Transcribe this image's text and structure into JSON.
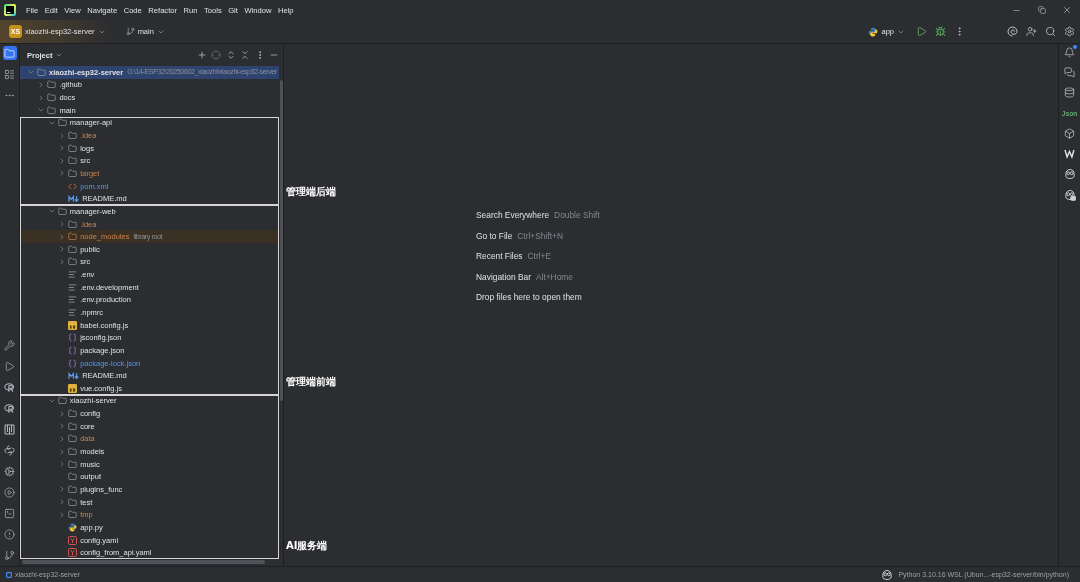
{
  "menu": [
    "File",
    "Edit",
    "View",
    "Navigate",
    "Code",
    "Refactor",
    "Run",
    "Tools",
    "Git",
    "Window",
    "Help"
  ],
  "toolbar": {
    "project_badge": "XS",
    "project": "xiaozhi-esp32-server",
    "branch": "main",
    "run_configuration": "app"
  },
  "left_toolbar": {
    "top": [
      {
        "kind": "project",
        "selected": true
      },
      {
        "kind": "structure",
        "selected": false
      },
      {
        "kind": "more",
        "selected": false
      }
    ],
    "bottom": [
      {
        "kind": "build",
        "selected": false
      },
      {
        "kind": "run",
        "selected": false
      },
      {
        "kind": "r-console",
        "selected": false
      },
      {
        "kind": "r-packages",
        "selected": false
      },
      {
        "kind": "columns",
        "selected": false
      },
      {
        "kind": "python-console",
        "selected": false
      },
      {
        "kind": "services",
        "selected": false
      },
      {
        "kind": "play-circle",
        "selected": false
      },
      {
        "kind": "terminal",
        "selected": false
      },
      {
        "kind": "problems",
        "selected": false
      },
      {
        "kind": "vcs",
        "selected": false
      }
    ]
  },
  "project_panel": {
    "title": "Project",
    "tree": [
      {
        "name": "xiaozhi-esp32-server",
        "hint": "G:\\14-ESP32\\20250602_xiaozhi\\xiaozhi-esp32-server",
        "kind": "folder",
        "ignored": false,
        "modified": false,
        "expanded": true,
        "selected": true,
        "highlighted": false,
        "children": [
          {
            "name": ".github",
            "kind": "folder",
            "ignored": false,
            "modified": false,
            "expanded": false,
            "selected": false,
            "highlighted": false
          },
          {
            "name": "docs",
            "kind": "folder",
            "ignored": false,
            "modified": false,
            "expanded": false,
            "selected": false,
            "highlighted": false
          },
          {
            "name": "main",
            "kind": "folder",
            "ignored": false,
            "modified": false,
            "expanded": true,
            "selected": false,
            "highlighted": false,
            "children": [
              {
                "name": "manager-api",
                "kind": "folder",
                "ignored": false,
                "modified": false,
                "expanded": true,
                "selected": false,
                "highlighted": false,
                "annotation": "管理端后端",
                "children": [
                  {
                    "name": ".idea",
                    "kind": "folder",
                    "ignored": true,
                    "modified": false,
                    "expanded": false,
                    "selected": false,
                    "highlighted": false
                  },
                  {
                    "name": "logs",
                    "kind": "folder",
                    "ignored": false,
                    "modified": false,
                    "expanded": false,
                    "selected": false,
                    "highlighted": false
                  },
                  {
                    "name": "src",
                    "kind": "folder",
                    "ignored": false,
                    "modified": false,
                    "expanded": false,
                    "selected": false,
                    "highlighted": false
                  },
                  {
                    "name": "target",
                    "kind": "folder",
                    "ignored": true,
                    "modified": false,
                    "expanded": false,
                    "selected": false,
                    "highlighted": false
                  },
                  {
                    "name": "pom.xml",
                    "kind": "xml",
                    "ignored": false,
                    "modified": true,
                    "selected": false,
                    "highlighted": false
                  },
                  {
                    "name": "README.md",
                    "kind": "markdown",
                    "ignored": false,
                    "modified": false,
                    "selected": false,
                    "highlighted": false
                  }
                ]
              },
              {
                "name": "manager-web",
                "kind": "folder",
                "ignored": false,
                "modified": false,
                "expanded": true,
                "selected": false,
                "highlighted": false,
                "annotation": "管理端前端",
                "children": [
                  {
                    "name": ".idea",
                    "kind": "folder",
                    "ignored": true,
                    "modified": false,
                    "expanded": false,
                    "selected": false,
                    "highlighted": false
                  },
                  {
                    "name": "node_modules",
                    "hint": "library root",
                    "kind": "folder",
                    "ignored": true,
                    "modified": false,
                    "expanded": false,
                    "selected": false,
                    "highlighted": true
                  },
                  {
                    "name": "public",
                    "kind": "folder",
                    "ignored": false,
                    "modified": false,
                    "expanded": false,
                    "selected": false,
                    "highlighted": false
                  },
                  {
                    "name": "src",
                    "kind": "folder",
                    "ignored": false,
                    "modified": false,
                    "expanded": false,
                    "selected": false,
                    "highlighted": false
                  },
                  {
                    "name": ".env",
                    "kind": "text",
                    "ignored": false,
                    "modified": false,
                    "selected": false,
                    "highlighted": false
                  },
                  {
                    "name": ".env.development",
                    "kind": "text",
                    "ignored": false,
                    "modified": false,
                    "selected": false,
                    "highlighted": false
                  },
                  {
                    "name": ".env.production",
                    "kind": "text",
                    "ignored": false,
                    "modified": false,
                    "selected": false,
                    "highlighted": false
                  },
                  {
                    "name": ".npmrc",
                    "kind": "text",
                    "ignored": false,
                    "modified": false,
                    "selected": false,
                    "highlighted": false
                  },
                  {
                    "name": "babel.config.js",
                    "kind": "js",
                    "ignored": false,
                    "modified": false,
                    "selected": false,
                    "highlighted": false
                  },
                  {
                    "name": "jsconfig.json",
                    "kind": "json",
                    "ignored": false,
                    "modified": false,
                    "selected": false,
                    "highlighted": false
                  },
                  {
                    "name": "package.json",
                    "kind": "json",
                    "ignored": false,
                    "modified": false,
                    "selected": false,
                    "highlighted": false
                  },
                  {
                    "name": "package-lock.json",
                    "kind": "json",
                    "ignored": false,
                    "modified": true,
                    "selected": false,
                    "highlighted": false
                  },
                  {
                    "name": "README.md",
                    "kind": "markdown",
                    "ignored": false,
                    "modified": false,
                    "selected": false,
                    "highlighted": false
                  },
                  {
                    "name": "vue.config.js",
                    "kind": "js",
                    "ignored": false,
                    "modified": false,
                    "selected": false,
                    "highlighted": false
                  }
                ]
              },
              {
                "name": "xiaozhi-server",
                "kind": "folder",
                "ignored": false,
                "modified": false,
                "expanded": true,
                "selected": false,
                "highlighted": false,
                "annotation": "AI服务端",
                "children": [
                  {
                    "name": "config",
                    "kind": "folder",
                    "ignored": false,
                    "modified": false,
                    "expanded": false,
                    "selected": false,
                    "highlighted": false
                  },
                  {
                    "name": "core",
                    "kind": "folder",
                    "ignored": false,
                    "modified": false,
                    "expanded": false,
                    "selected": false,
                    "highlighted": false
                  },
                  {
                    "name": "data",
                    "kind": "folder",
                    "ignored": true,
                    "modified": false,
                    "expanded": false,
                    "selected": false,
                    "highlighted": false
                  },
                  {
                    "name": "models",
                    "kind": "folder",
                    "ignored": false,
                    "modified": false,
                    "expanded": false,
                    "selected": false,
                    "highlighted": false
                  },
                  {
                    "name": "music",
                    "kind": "folder",
                    "ignored": false,
                    "modified": false,
                    "expanded": false,
                    "selected": false,
                    "highlighted": false
                  },
                  {
                    "name": "output",
                    "kind": "empty-folder",
                    "ignored": false,
                    "modified": false,
                    "selected": false,
                    "highlighted": false
                  },
                  {
                    "name": "plugins_func",
                    "kind": "folder",
                    "ignored": false,
                    "modified": false,
                    "expanded": false,
                    "selected": false,
                    "highlighted": false
                  },
                  {
                    "name": "test",
                    "kind": "folder",
                    "ignored": false,
                    "modified": false,
                    "expanded": false,
                    "selected": false,
                    "highlighted": false
                  },
                  {
                    "name": "tmp",
                    "kind": "folder",
                    "ignored": true,
                    "modified": false,
                    "expanded": false,
                    "selected": false,
                    "highlighted": false
                  },
                  {
                    "name": "app.py",
                    "kind": "python",
                    "ignored": false,
                    "modified": false,
                    "selected": false,
                    "highlighted": false
                  },
                  {
                    "name": "config.yaml",
                    "kind": "yaml",
                    "ignored": false,
                    "modified": false,
                    "selected": false,
                    "highlighted": false
                  },
                  {
                    "name": "config_from_api.yaml",
                    "kind": "yaml",
                    "ignored": false,
                    "modified": false,
                    "selected": false,
                    "highlighted": false
                  }
                ]
              }
            ]
          }
        ]
      }
    ]
  },
  "editor_hints": [
    {
      "action": "Search Everywhere",
      "shortcut": "Double Shift"
    },
    {
      "action": "Go to File",
      "shortcut": "Ctrl+Shift+N"
    },
    {
      "action": "Recent Files",
      "shortcut": "Ctrl+E"
    },
    {
      "action": "Navigation Bar",
      "shortcut": "Alt+Home"
    },
    {
      "action": "Drop files here to open them"
    }
  ],
  "right_toolbar": [
    {
      "kind": "notifications",
      "unread": true
    },
    {
      "kind": "ai-chat"
    },
    {
      "kind": "database"
    },
    {
      "kind": "json",
      "label": "Json"
    },
    {
      "kind": "plugin"
    },
    {
      "kind": "w-logo"
    },
    {
      "kind": "copilot"
    },
    {
      "kind": "copilot-chat"
    }
  ],
  "status_bar": {
    "breadcrumb": "xiaozhi-esp32-server",
    "interpreter": "Python 3.10.16 WSL (Ubun...-esp32-server/bin/python)"
  }
}
